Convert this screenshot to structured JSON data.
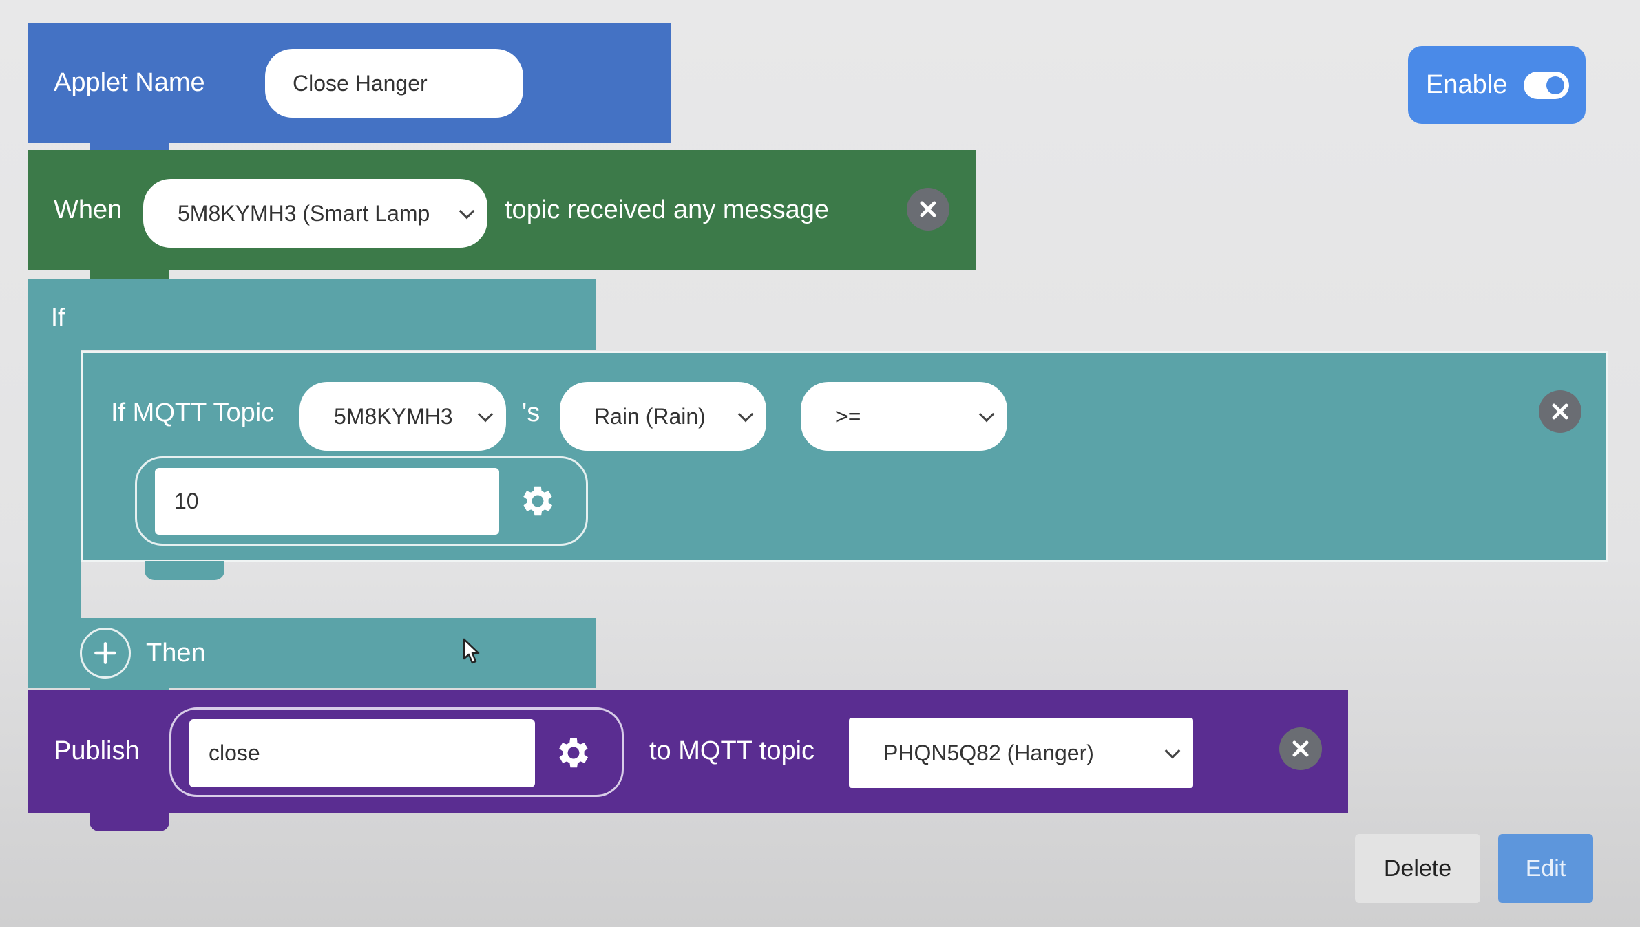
{
  "applet": {
    "label": "Applet Name",
    "name": "Close Hanger"
  },
  "enable": {
    "label": "Enable",
    "state": "on"
  },
  "trigger": {
    "label": "When",
    "device": "5M8KYMH3 (Smart Lamp",
    "text": "topic received any message"
  },
  "if_block": {
    "label": "If"
  },
  "condition": {
    "label": "If MQTT Topic",
    "device": "5M8KYMH3",
    "possessive": "'s",
    "field": "Rain (Rain)",
    "operator": ">=",
    "value": "10"
  },
  "then": {
    "label": "Then"
  },
  "publish": {
    "label": "Publish",
    "message": "close",
    "to_label": "to MQTT topic",
    "topic": "PHQN5Q82 (Hanger)"
  },
  "footer": {
    "delete": "Delete",
    "edit": "Edit"
  },
  "colors": {
    "applet_blue": "#4472c4",
    "trigger_green": "#3c7a49",
    "condition_teal": "#5ba3a8",
    "publish_purple": "#5a2d91",
    "enable_blue": "#4a8ae8",
    "edit_blue": "#5d96dc"
  }
}
